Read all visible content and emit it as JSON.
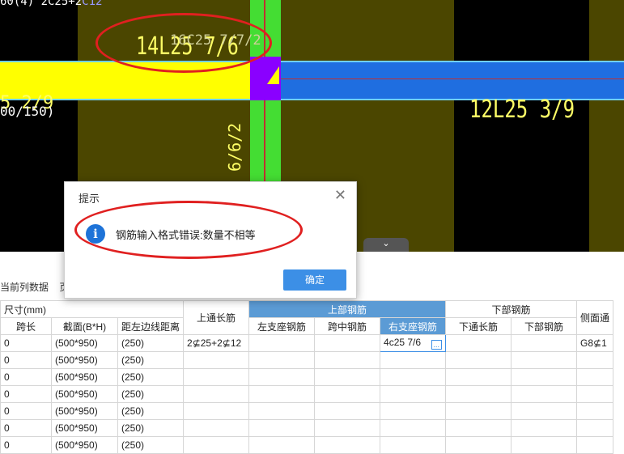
{
  "cad": {
    "top_left_label_a": "60(4) 2C25+2",
    "top_left_label_b": "C12",
    "beam_label_big": "14L25 7/6",
    "beam_label_small": "16C25 7/7/2",
    "left_label": "00/150)",
    "left_label_b": "5 2/9",
    "vertical_label": "6/6/2",
    "right_label": "12L25 3/9",
    "colors": {
      "background": "#000000",
      "olive": "#4b4600",
      "green_column": "#44dd33",
      "yellow_beam": "#ffff00",
      "blue_beam": "#1f6ee0",
      "purple": "#8a00ff",
      "red_annotation": "#e02020"
    }
  },
  "dialog": {
    "title": "提示",
    "message": "钢筋输入格式错误:数量不相等",
    "ok_label": "确定",
    "close_icon": "close-icon",
    "info_icon": "info-icon",
    "info_glyph": "i"
  },
  "toolbar": {
    "item1": "当前列数据",
    "item2": "页"
  },
  "table": {
    "size_group": "尺寸(mm)",
    "top_through": "上通长筋",
    "top_rebar_group": "上部钢筋",
    "bottom_rebar_group": "下部钢筋",
    "side_group": "侧面通",
    "cols": [
      "跨长",
      "截面(B*H)",
      "距左边线距离",
      "左支座钢筋",
      "跨中钢筋",
      "右支座钢筋",
      "下通长筋",
      "下部钢筋"
    ],
    "rows": [
      {
        "span": "0",
        "section": "(500*950)",
        "dist": "(250)",
        "top_through": "2⊈25+2⊈12",
        "left": "",
        "mid": "",
        "right": "4c25 7/6",
        "bot_through": "",
        "bot": "",
        "side": "G8⊈1"
      },
      {
        "span": "0",
        "section": "(500*950)",
        "dist": "(250)",
        "top_through": "",
        "left": "",
        "mid": "",
        "right": "",
        "bot_through": "",
        "bot": "",
        "side": ""
      },
      {
        "span": "0",
        "section": "(500*950)",
        "dist": "(250)",
        "top_through": "",
        "left": "",
        "mid": "",
        "right": "",
        "bot_through": "",
        "bot": "",
        "side": ""
      },
      {
        "span": "0",
        "section": "(500*950)",
        "dist": "(250)",
        "top_through": "",
        "left": "",
        "mid": "",
        "right": "",
        "bot_through": "",
        "bot": "",
        "side": ""
      },
      {
        "span": "0",
        "section": "(500*950)",
        "dist": "(250)",
        "top_through": "",
        "left": "",
        "mid": "",
        "right": "",
        "bot_through": "",
        "bot": "",
        "side": ""
      },
      {
        "span": "0",
        "section": "(500*950)",
        "dist": "(250)",
        "top_through": "",
        "left": "",
        "mid": "",
        "right": "",
        "bot_through": "",
        "bot": "",
        "side": ""
      },
      {
        "span": "0",
        "section": "(500*950)",
        "dist": "(250)",
        "top_through": "",
        "left": "",
        "mid": "",
        "right": "",
        "bot_through": "",
        "bot": "",
        "side": ""
      }
    ],
    "edit_button": "..."
  }
}
